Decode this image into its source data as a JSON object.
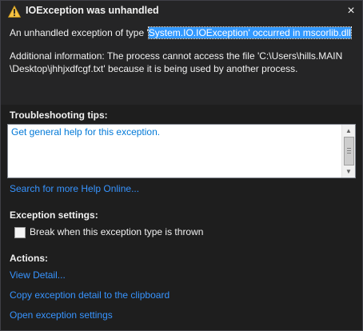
{
  "dialog": {
    "title": "IOException was unhandled",
    "close_glyph": "×",
    "message_prefix": "An unhandled exception of type '",
    "message_highlight": "System.IO.IOException' occurred in mscorlib.dll",
    "info_line1": "Additional information: The process cannot access the file 'C:\\Users\\hills.MAIN",
    "info_line2": "\\Desktop\\jhhjxdfcgf.txt' because it is being used by another process."
  },
  "troubleshooting": {
    "label": "Troubleshooting tips:",
    "tip": "Get general help for this exception.",
    "search_link": "Search for more Help Online..."
  },
  "exception_settings": {
    "label": "Exception settings:",
    "checkbox_label": "Break when this exception type is thrown",
    "checked": false
  },
  "actions": {
    "label": "Actions:",
    "items": [
      "View Detail...",
      "Copy exception detail to the clipboard",
      "Open exception settings"
    ]
  },
  "colors": {
    "background": "#2d2d30",
    "link": "#3794ff",
    "warning": "#f6c342"
  },
  "icons": {
    "warning": "warning-triangle-icon",
    "close": "close-icon"
  }
}
